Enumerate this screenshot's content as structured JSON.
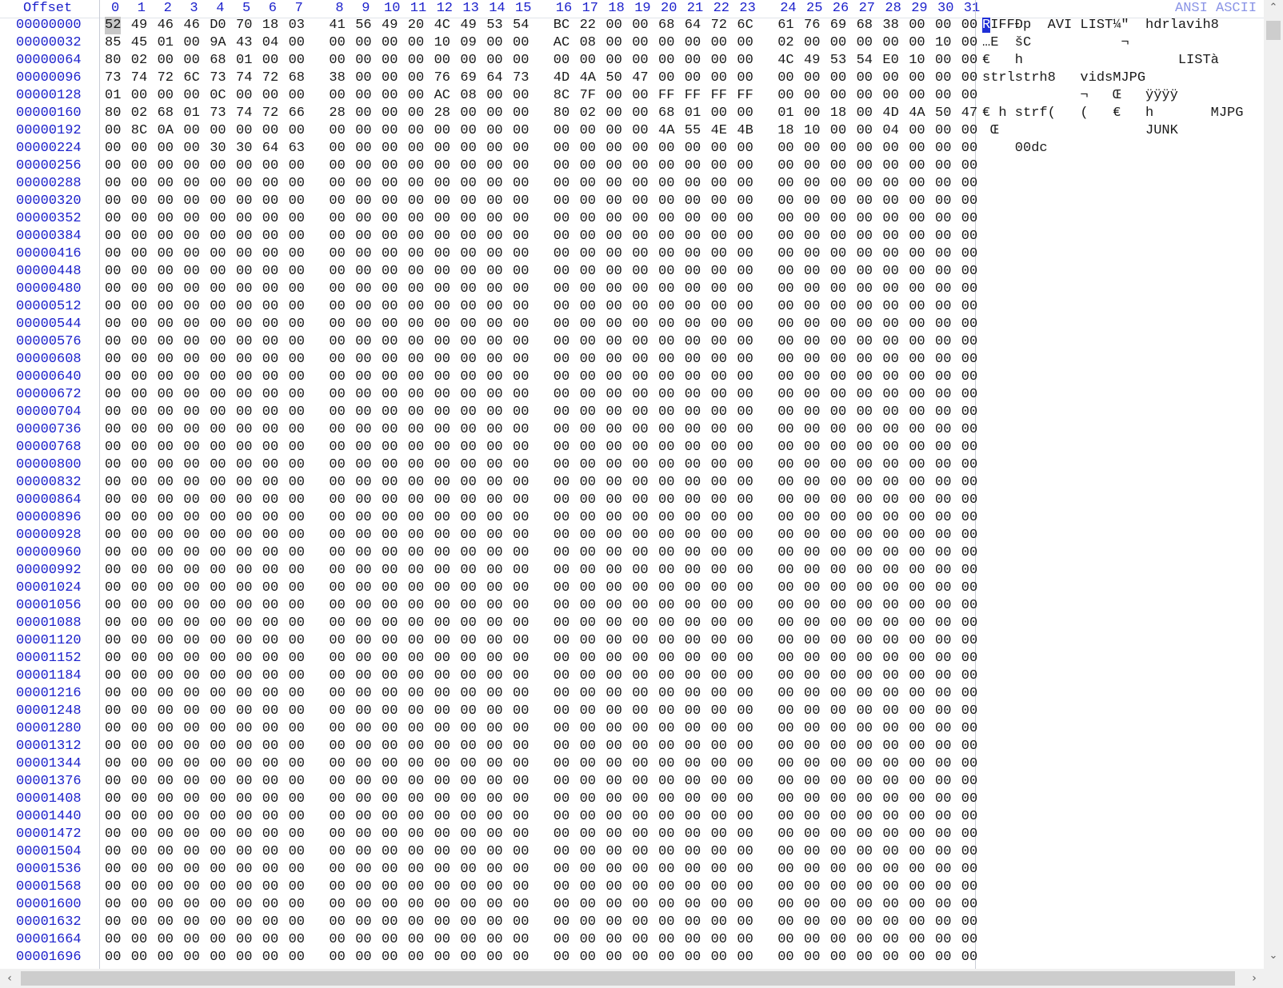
{
  "header": {
    "offset_label": "Offset",
    "columns": [
      "0",
      "1",
      "2",
      "3",
      "4",
      "5",
      "6",
      "7",
      "8",
      "9",
      "10",
      "11",
      "12",
      "13",
      "14",
      "15",
      "16",
      "17",
      "18",
      "19",
      "20",
      "21",
      "22",
      "23",
      "24",
      "25",
      "26",
      "27",
      "28",
      "29",
      "30",
      "31"
    ],
    "ascii_label": "ANSI ASCII"
  },
  "rows": [
    {
      "offset": "00000000",
      "hex": "52 49 46 46 D0 70 18 03 41 56 49 20 4C 49 53 54 BC 22 00 00 68 64 72 6C 61 76 69 68 38 00 00 00",
      "ascii": "RIFFÐp  AVI LIST¼\"  hdrlavih8"
    },
    {
      "offset": "00000032",
      "hex": "85 45 01 00 9A 43 04 00 00 00 00 00 10 09 00 00 AC 08 00 00 00 00 00 00 02 00 00 00 00 00 10 00",
      "ascii": "…E  šC           ¬"
    },
    {
      "offset": "00000064",
      "hex": "80 02 00 00 68 01 00 00 00 00 00 00 00 00 00 00 00 00 00 00 00 00 00 00 4C 49 53 54 E0 10 00 00",
      "ascii": "€   h                   LISTà"
    },
    {
      "offset": "00000096",
      "hex": "73 74 72 6C 73 74 72 68 38 00 00 00 76 69 64 73 4D 4A 50 47 00 00 00 00 00 00 00 00 00 00 00 00",
      "ascii": "strlstrh8   vidsMJPG"
    },
    {
      "offset": "00000128",
      "hex": "01 00 00 00 0C 00 00 00 00 00 00 00 AC 08 00 00 8C 7F 00 00 FF FF FF FF 00 00 00 00 00 00 00 00",
      "ascii": "            ¬   Œ   ÿÿÿÿ"
    },
    {
      "offset": "00000160",
      "hex": "80 02 68 01 73 74 72 66 28 00 00 00 28 00 00 00 80 02 00 00 68 01 00 00 01 00 18 00 4D 4A 50 47",
      "ascii": "€ h strf(   (   €   h       MJPG"
    },
    {
      "offset": "00000192",
      "hex": "00 8C 0A 00 00 00 00 00 00 00 00 00 00 00 00 00 00 00 00 00 4A 55 4E 4B 18 10 00 00 04 00 00 00",
      "ascii": " Œ                  JUNK"
    },
    {
      "offset": "00000224",
      "hex": "00 00 00 00 30 30 64 63 00 00 00 00 00 00 00 00 00 00 00 00 00 00 00 00 00 00 00 00 00 00 00 00",
      "ascii": "    00dc"
    },
    {
      "offset": "00000256",
      "hex": "",
      "ascii": ""
    },
    {
      "offset": "00000288",
      "hex": "",
      "ascii": ""
    },
    {
      "offset": "00000320",
      "hex": "",
      "ascii": ""
    },
    {
      "offset": "00000352",
      "hex": "",
      "ascii": ""
    },
    {
      "offset": "00000384",
      "hex": "",
      "ascii": ""
    },
    {
      "offset": "00000416",
      "hex": "",
      "ascii": ""
    },
    {
      "offset": "00000448",
      "hex": "",
      "ascii": ""
    },
    {
      "offset": "00000480",
      "hex": "",
      "ascii": ""
    },
    {
      "offset": "00000512",
      "hex": "",
      "ascii": ""
    },
    {
      "offset": "00000544",
      "hex": "",
      "ascii": ""
    },
    {
      "offset": "00000576",
      "hex": "",
      "ascii": ""
    },
    {
      "offset": "00000608",
      "hex": "",
      "ascii": ""
    },
    {
      "offset": "00000640",
      "hex": "",
      "ascii": ""
    },
    {
      "offset": "00000672",
      "hex": "",
      "ascii": ""
    },
    {
      "offset": "00000704",
      "hex": "",
      "ascii": ""
    },
    {
      "offset": "00000736",
      "hex": "",
      "ascii": ""
    },
    {
      "offset": "00000768",
      "hex": "",
      "ascii": ""
    },
    {
      "offset": "00000800",
      "hex": "",
      "ascii": ""
    },
    {
      "offset": "00000832",
      "hex": "",
      "ascii": ""
    },
    {
      "offset": "00000864",
      "hex": "",
      "ascii": ""
    },
    {
      "offset": "00000896",
      "hex": "",
      "ascii": ""
    },
    {
      "offset": "00000928",
      "hex": "",
      "ascii": ""
    },
    {
      "offset": "00000960",
      "hex": "",
      "ascii": ""
    },
    {
      "offset": "00000992",
      "hex": "",
      "ascii": ""
    },
    {
      "offset": "00001024",
      "hex": "",
      "ascii": ""
    },
    {
      "offset": "00001056",
      "hex": "",
      "ascii": ""
    },
    {
      "offset": "00001088",
      "hex": "",
      "ascii": ""
    },
    {
      "offset": "00001120",
      "hex": "",
      "ascii": ""
    },
    {
      "offset": "00001152",
      "hex": "",
      "ascii": ""
    },
    {
      "offset": "00001184",
      "hex": "",
      "ascii": ""
    },
    {
      "offset": "00001216",
      "hex": "",
      "ascii": ""
    },
    {
      "offset": "00001248",
      "hex": "",
      "ascii": ""
    },
    {
      "offset": "00001280",
      "hex": "",
      "ascii": ""
    },
    {
      "offset": "00001312",
      "hex": "",
      "ascii": ""
    },
    {
      "offset": "00001344",
      "hex": "",
      "ascii": ""
    },
    {
      "offset": "00001376",
      "hex": "",
      "ascii": ""
    },
    {
      "offset": "00001408",
      "hex": "",
      "ascii": ""
    },
    {
      "offset": "00001440",
      "hex": "",
      "ascii": ""
    },
    {
      "offset": "00001472",
      "hex": "",
      "ascii": ""
    },
    {
      "offset": "00001504",
      "hex": "",
      "ascii": ""
    },
    {
      "offset": "00001536",
      "hex": "",
      "ascii": ""
    },
    {
      "offset": "00001568",
      "hex": "",
      "ascii": ""
    },
    {
      "offset": "00001600",
      "hex": "",
      "ascii": ""
    },
    {
      "offset": "00001632",
      "hex": "",
      "ascii": ""
    },
    {
      "offset": "00001664",
      "hex": "",
      "ascii": ""
    },
    {
      "offset": "00001696",
      "hex": "",
      "ascii": ""
    }
  ],
  "empty_row_byte": "00",
  "scrollbar": {
    "up_icon": "chevron-up-icon",
    "down_icon": "chevron-down-icon",
    "left_icon": "chevron-left-icon",
    "right_icon": "chevron-right-icon"
  },
  "colors": {
    "header_text": "#1d22cc",
    "ascii_header_text": "#8a94e6",
    "caret": "#1f2fd6",
    "selected_byte": "#c8c8c8"
  }
}
